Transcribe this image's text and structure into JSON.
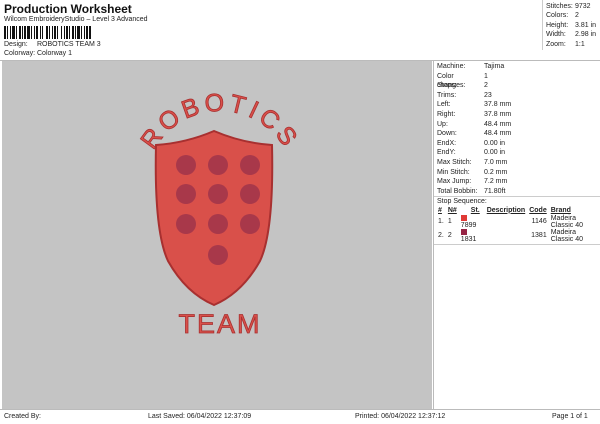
{
  "header": {
    "title": "Production Worksheet",
    "subtitle": "Wilcom EmbroideryStudio – Level 3 Advanced",
    "design_label": "Design:",
    "design_value": "ROBOTICS TEAM 3",
    "colorway_label": "Colorway:",
    "colorway_value": "Colorway 1"
  },
  "stats": [
    {
      "label": "Stitches:",
      "value": "9732"
    },
    {
      "label": "Colors:",
      "value": "2"
    },
    {
      "label": "Height:",
      "value": "3.81 in"
    },
    {
      "label": "Width:",
      "value": "2.98 in"
    },
    {
      "label": "Zoom:",
      "value": "1:1"
    }
  ],
  "design": {
    "arc_text": "ROBOTICS",
    "bottom_text": "TEAM",
    "thread_color": "#d9504a",
    "dot_color": "#a8384a"
  },
  "details": [
    {
      "label": "Machine:",
      "value": "Tajima"
    },
    {
      "label": "Color changes:",
      "value": "1"
    },
    {
      "label": "Stops:",
      "value": "2"
    },
    {
      "label": "Trims:",
      "value": "23"
    },
    {
      "label": "Left:",
      "value": "37.8 mm"
    },
    {
      "label": "Right:",
      "value": "37.8 mm"
    },
    {
      "label": "Up:",
      "value": "48.4 mm"
    },
    {
      "label": "Down:",
      "value": "48.4 mm"
    },
    {
      "label": "EndX:",
      "value": "0.00 in"
    },
    {
      "label": "EndY:",
      "value": "0.00 in"
    },
    {
      "label": "Max Stitch:",
      "value": "7.0 mm"
    },
    {
      "label": "Min Stitch:",
      "value": "0.2 mm"
    },
    {
      "label": "Max Jump:",
      "value": "7.2 mm"
    },
    {
      "label": "Total Bobbin:",
      "value": "71.80ft"
    }
  ],
  "stop_sequence": {
    "title": "Stop Sequence:",
    "headers": [
      "#",
      "N#",
      "St.",
      "Description",
      "Code",
      "Brand"
    ],
    "rows": [
      {
        "n": "1.",
        "needle": "1",
        "color": "#e03a36",
        "st": "7899",
        "desc": "",
        "code": "1146",
        "brand": "Madeira Classic 40"
      },
      {
        "n": "2.",
        "needle": "2",
        "color": "#962444",
        "st": "1831",
        "desc": "",
        "code": "1381",
        "brand": "Madeira Classic 40"
      }
    ]
  },
  "footer": {
    "created": "Created By:",
    "saved": "Last Saved: 06/04/2022 12:37:09",
    "printed": "Printed: 06/04/2022 12:37:12",
    "page": "Page 1 of 1"
  }
}
